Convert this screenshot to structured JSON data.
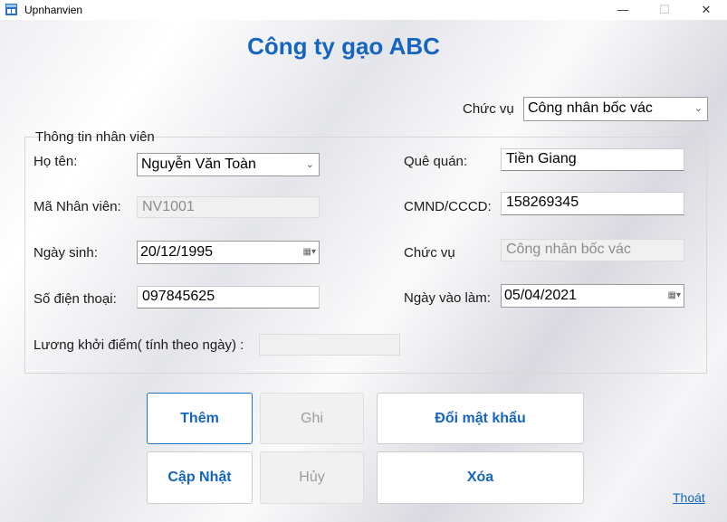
{
  "window": {
    "title": "Upnhanvien",
    "minimize_glyph": "—",
    "maximize_glyph": "☐",
    "close_glyph": "✕"
  },
  "heading": "Công ty gạo ABC",
  "top": {
    "role_label": "Chức vụ",
    "role_select": "Công nhân bốc vác"
  },
  "group": {
    "title": "Thông tin nhân viên",
    "name_label": "Họ tên:",
    "name_value": "Nguyễn Văn Toàn",
    "id_label": "Mã Nhân viên:",
    "id_value": "NV1001",
    "dob_label": "Ngày sinh:",
    "dob_value": "20/12/1995",
    "phone_label": "Số điện thoại:",
    "phone_value": "097845625",
    "salary_label": "Lương khởi điểm( tính theo ngày) :",
    "salary_value": "",
    "hometown_label": "Quê quán:",
    "hometown_value": "Tiền Giang",
    "cmnd_label": "CMND/CCCD:",
    "cmnd_value": "158269345",
    "role_label": "Chức vụ",
    "role_value": "Công nhân bốc vác",
    "start_label": "Ngày vào làm:",
    "start_value": "05/04/2021"
  },
  "buttons": {
    "add": "Thêm",
    "save": "Ghi",
    "change_password": "Đổi mật khẩu",
    "update": "Cập Nhật",
    "cancel": "Hủy",
    "delete": "Xóa"
  },
  "logout": "Thoát",
  "colors": {
    "accent": "#1565c0",
    "disabled_text": "#9c9c9c"
  }
}
